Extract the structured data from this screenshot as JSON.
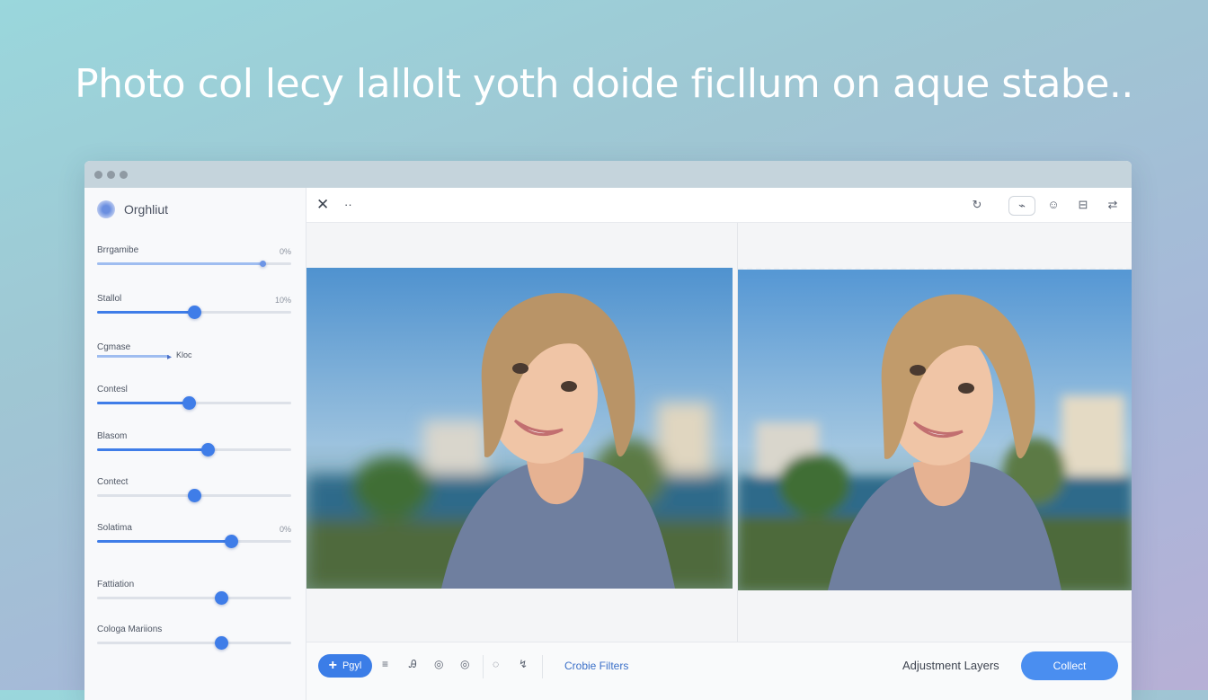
{
  "headline": "Photo col lecy lallolt yoth doide ficllum on aque stabe..",
  "sidebar": {
    "title": "Orghliut",
    "sliders": [
      {
        "label": "Brrgamibe",
        "value_text": "0%",
        "level": 0.85
      },
      {
        "label": "Stallol",
        "value_text": "10%",
        "level": 0.5
      },
      {
        "label": "Cgmase",
        "value_text": "Kloc",
        "level": 0.37
      },
      {
        "label": "Contesl",
        "value_text": "",
        "level": 0.47
      },
      {
        "label": "Blasom",
        "value_text": "",
        "level": 0.57
      },
      {
        "label": "Contect",
        "value_text": "",
        "level": 0.5
      },
      {
        "label": "Solatima",
        "value_text": "0%",
        "level": 0.69
      },
      {
        "label": "Fattiation",
        "value_text": "",
        "level": 0.64
      },
      {
        "label": "Cologa Mariions",
        "value_text": "",
        "level": 0.64
      }
    ]
  },
  "toolbar": {
    "close_icon": "✕",
    "more_icon": "··",
    "right_icons": [
      "↻",
      "⌁",
      "☺",
      "⊟",
      "⇄"
    ]
  },
  "bottom": {
    "add_label": "Pgyl",
    "filters_link": "Crobie Filters",
    "adjustment_layers": "Adjustment Layers",
    "collect_label": "Collect",
    "tool_icons": [
      "≡",
      "Ꭿ",
      "◎",
      "◎",
      "◌",
      "↯"
    ]
  },
  "colors": {
    "accent": "#3f7de8",
    "button": "#4a8ef0",
    "link": "#3a6fc8"
  }
}
